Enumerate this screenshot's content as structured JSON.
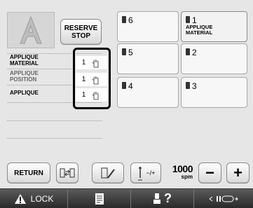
{
  "reserve_stop": {
    "line1": "RESERVE",
    "line2": "STOP"
  },
  "color_list": [
    {
      "name_line1": "APPLIQUE",
      "name_line2": "MATERIAL",
      "needle": "1"
    },
    {
      "name_line1": "APPLIQUE",
      "name_line2": "POSITION",
      "needle": "1"
    },
    {
      "name_line1": "APPLIQUE",
      "name_line2": "",
      "needle": "1"
    }
  ],
  "needles": [
    {
      "number": "6",
      "line1": "",
      "line2": ""
    },
    {
      "number": "1",
      "line1": "APPLIQUE",
      "line2": "MATERIAL"
    },
    {
      "number": "5",
      "line1": "",
      "line2": ""
    },
    {
      "number": "2",
      "line1": "",
      "line2": ""
    },
    {
      "number": "4",
      "line1": "",
      "line2": ""
    },
    {
      "number": "3",
      "line1": "",
      "line2": ""
    }
  ],
  "buttons": {
    "return": "RETURN",
    "speed_value": "1000",
    "speed_unit": "spm",
    "minus": "−",
    "plus": "+",
    "needle_adjust": "−/+"
  },
  "bottom_bar": {
    "lock": "LOCK",
    "help": "?"
  }
}
